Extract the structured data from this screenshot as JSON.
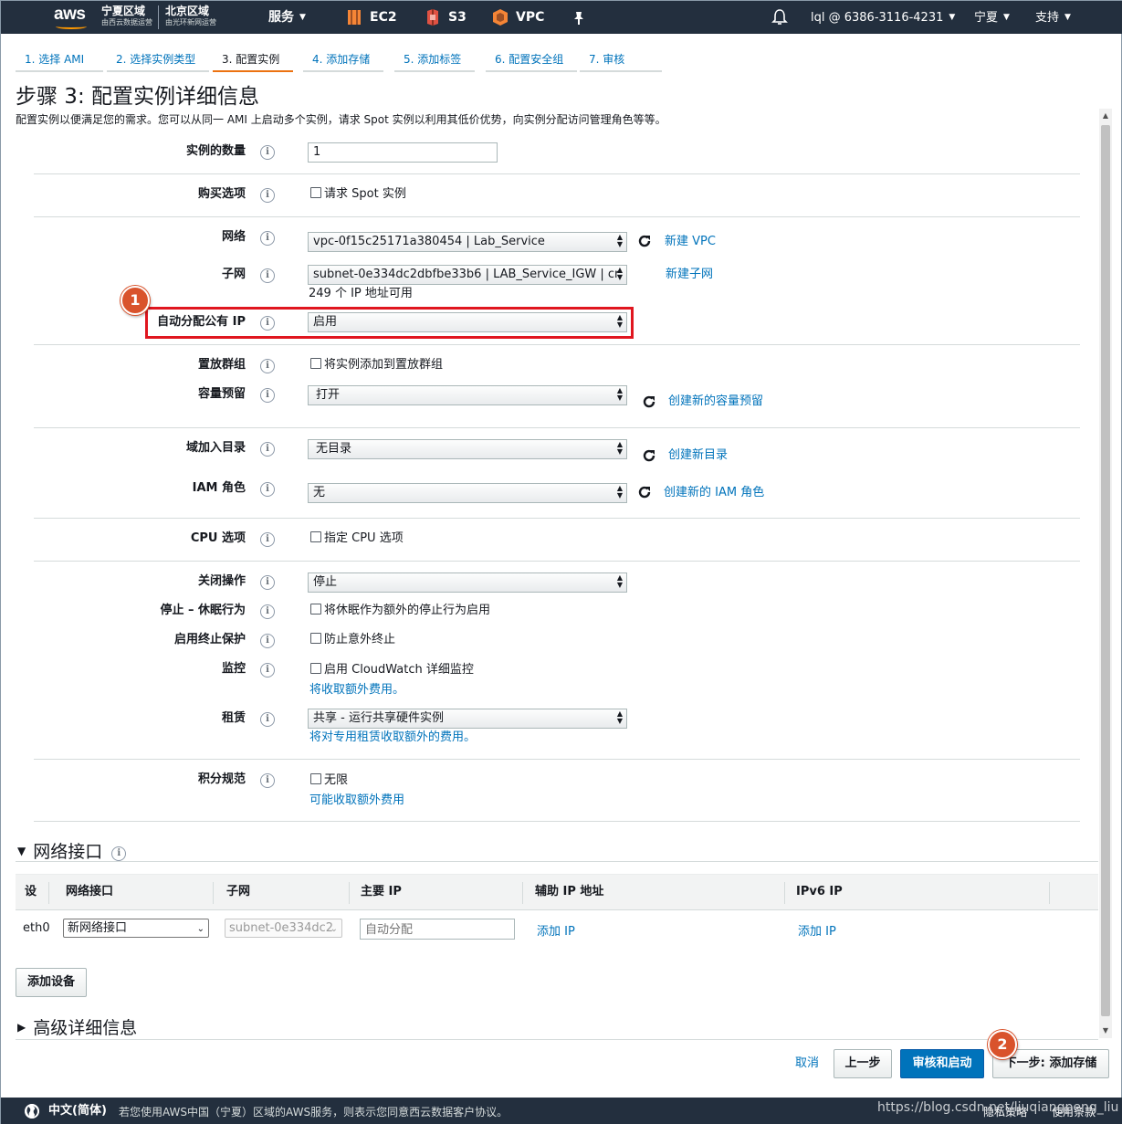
{
  "topnav": {
    "region1_title": "宁夏区域",
    "region1_sub": "由西云数据运营",
    "region2_title": "北京区域",
    "region2_sub": "由光环新网运营",
    "services_label": "服务",
    "ec2_label": "EC2",
    "s3_label": "S3",
    "vpc_label": "VPC",
    "account_label": "lql @ 6386-3116-4231",
    "region_label": "宁夏",
    "support_label": "支持",
    "logo_text": "aws"
  },
  "tabs": [
    {
      "label": "1. 选择 AMI",
      "active": false
    },
    {
      "label": "2. 选择实例类型",
      "active": false
    },
    {
      "label": "3. 配置实例",
      "active": true
    },
    {
      "label": "4. 添加存储",
      "active": false
    },
    {
      "label": "5. 添加标签",
      "active": false
    },
    {
      "label": "6. 配置安全组",
      "active": false
    },
    {
      "label": "7. 审核",
      "active": false
    }
  ],
  "page": {
    "title": "步骤 3: 配置实例详细信息",
    "description": "配置实例以便满足您的需求。您可以从同一 AMI 上启动多个实例，请求 Spot 实例以利用其低价优势，向实例分配访问管理角色等等。"
  },
  "form": {
    "instance_count": {
      "label": "实例的数量",
      "value": "1"
    },
    "purchase": {
      "label": "购买选项",
      "checkbox": "请求 Spot 实例"
    },
    "network": {
      "label": "网络",
      "value": "vpc-0f15c25171a380454 | Lab_Service",
      "link": "新建 VPC"
    },
    "subnet": {
      "label": "子网",
      "value": "subnet-0e334dc2dbfbe33b6 | LAB_Service_IGW | cr",
      "helper": "249 个 IP 地址可用",
      "link": "新建子网"
    },
    "auto_ip": {
      "label": "自动分配公有 IP",
      "value": "启用"
    },
    "placement": {
      "label": "置放群组",
      "checkbox": "将实例添加到置放群组"
    },
    "capacity": {
      "label": "容量预留",
      "value": "打开",
      "link": "创建新的容量预留"
    },
    "domain": {
      "label": "域加入目录",
      "value": "无目录",
      "link": "创建新目录"
    },
    "iam": {
      "label": "IAM 角色",
      "value": "无",
      "link": "创建新的 IAM 角色"
    },
    "cpu": {
      "label": "CPU 选项",
      "checkbox": "指定 CPU 选项"
    },
    "shutdown": {
      "label": "关闭操作",
      "value": "停止"
    },
    "hibernate": {
      "label": "停止 – 休眠行为",
      "checkbox": "将休眠作为额外的停止行为启用"
    },
    "termination": {
      "label": "启用终止保护",
      "checkbox": "防止意外终止"
    },
    "monitoring": {
      "label": "监控",
      "checkbox": "启用 CloudWatch 详细监控",
      "link": "将收取额外费用。"
    },
    "tenancy": {
      "label": "租赁",
      "value": "共享 - 运行共享硬件实例",
      "link": "将对专用租赁收取额外的费用。"
    },
    "credit": {
      "label": "积分规范",
      "checkbox": "无限",
      "link": "可能收取额外费用"
    },
    "info_glyph": "i"
  },
  "markers": {
    "one": "1",
    "two": "2"
  },
  "network_interfaces": {
    "title": "网络接口",
    "columns": [
      "设",
      "网络接口",
      "子网",
      "主要 IP",
      "辅助 IP 地址",
      "IPv6 IP"
    ],
    "row": {
      "device": "eth0",
      "interface": "新网络接口",
      "subnet": "subnet-0e334dc2",
      "primary_ip_placeholder": "自动分配",
      "secondary_link": "添加 IP",
      "ipv6_link": "添加 IP"
    },
    "add_device_button": "添加设备"
  },
  "advanced": {
    "title": "高级详细信息"
  },
  "actions": {
    "cancel": "取消",
    "previous": "上一步",
    "review": "审核和启动",
    "next": "下一步: 添加存储"
  },
  "footer": {
    "language": "中文(简体)",
    "legal_text": "若您使用AWS中国（宁夏）区域的AWS服务，则表示您同意西云数据客户协议。",
    "privacy": "隐私策略",
    "terms": "使用条款",
    "watermark": "https://blog.csdn.net/liuqiangpeng_liu"
  },
  "colors": {
    "nav_bg": "#232f3e",
    "link": "#0073bb",
    "primary_button": "#0073bb",
    "active_tab": "#ec7211",
    "highlight_box": "#e0161f",
    "marker": "#d9532c"
  }
}
